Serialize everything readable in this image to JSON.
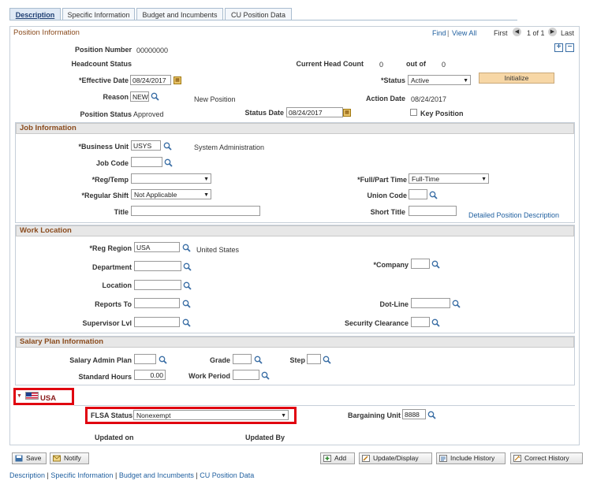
{
  "tabs": [
    "Description",
    "Specific Information",
    "Budget and Incumbents",
    "CU Position Data"
  ],
  "position_info": {
    "header": "Position Information",
    "find": "Find",
    "view_all": "View All",
    "first": "First",
    "count": "1 of 1",
    "last": "Last",
    "position_number_label": "Position Number",
    "position_number": "00000000",
    "headcount_status_label": "Headcount Status",
    "current_head_count_label": "Current Head Count",
    "current_head_count": "0",
    "out_of_label": "out of",
    "out_of": "0",
    "effective_date_label": "*Effective Date",
    "effective_date": "08/24/2017",
    "status_label": "*Status",
    "status": "Active",
    "initialize_label": "Initialize",
    "reason_label": "Reason",
    "reason": "NEW",
    "reason_desc": "New Position",
    "action_date_label": "Action Date",
    "action_date": "08/24/2017",
    "position_status_label": "Position Status",
    "position_status": "Approved",
    "status_date_label": "Status Date",
    "status_date": "08/24/2017",
    "key_position_label": "Key Position"
  },
  "job_info": {
    "header": "Job Information",
    "business_unit_label": "*Business Unit",
    "business_unit": "USYS",
    "business_unit_desc": "System Administration",
    "job_code_label": "Job Code",
    "reg_temp_label": "*Reg/Temp",
    "full_part_label": "*Full/Part Time",
    "full_part": "Full-Time",
    "regular_shift_label": "*Regular Shift",
    "regular_shift": "Not Applicable",
    "union_code_label": "Union Code",
    "title_label": "Title",
    "short_title_label": "Short Title",
    "detailed_link": "Detailed Position Description"
  },
  "work_location": {
    "header": "Work Location",
    "reg_region_label": "*Reg Region",
    "reg_region": "USA",
    "reg_region_desc": "United States",
    "department_label": "Department",
    "company_label": "*Company",
    "location_label": "Location",
    "reports_to_label": "Reports To",
    "dot_line_label": "Dot-Line",
    "supervisor_lvl_label": "Supervisor Lvl",
    "security_clearance_label": "Security Clearance"
  },
  "salary_plan": {
    "header": "Salary Plan Information",
    "admin_plan_label": "Salary Admin Plan",
    "grade_label": "Grade",
    "step_label": "Step",
    "standard_hours_label": "Standard Hours",
    "standard_hours": "0.00",
    "work_period_label": "Work Period"
  },
  "usa": {
    "label": "USA",
    "flsa_status_label": "FLSA Status",
    "flsa_status": "Nonexempt",
    "bargaining_unit_label": "Bargaining Unit",
    "bargaining_unit": "8888",
    "updated_on_label": "Updated on",
    "updated_by_label": "Updated By"
  },
  "toolbar": {
    "save": "Save",
    "notify": "Notify",
    "add": "Add",
    "update_display": "Update/Display",
    "include_history": "Include History",
    "correct_history": "Correct History"
  },
  "footer_links": [
    "Description",
    "Specific Information",
    "Budget and Incumbents",
    "CU Position Data"
  ],
  "colors": {
    "highlight": "#e0000f",
    "link": "#1f5f9f",
    "section_title": "#8a4b1d"
  }
}
